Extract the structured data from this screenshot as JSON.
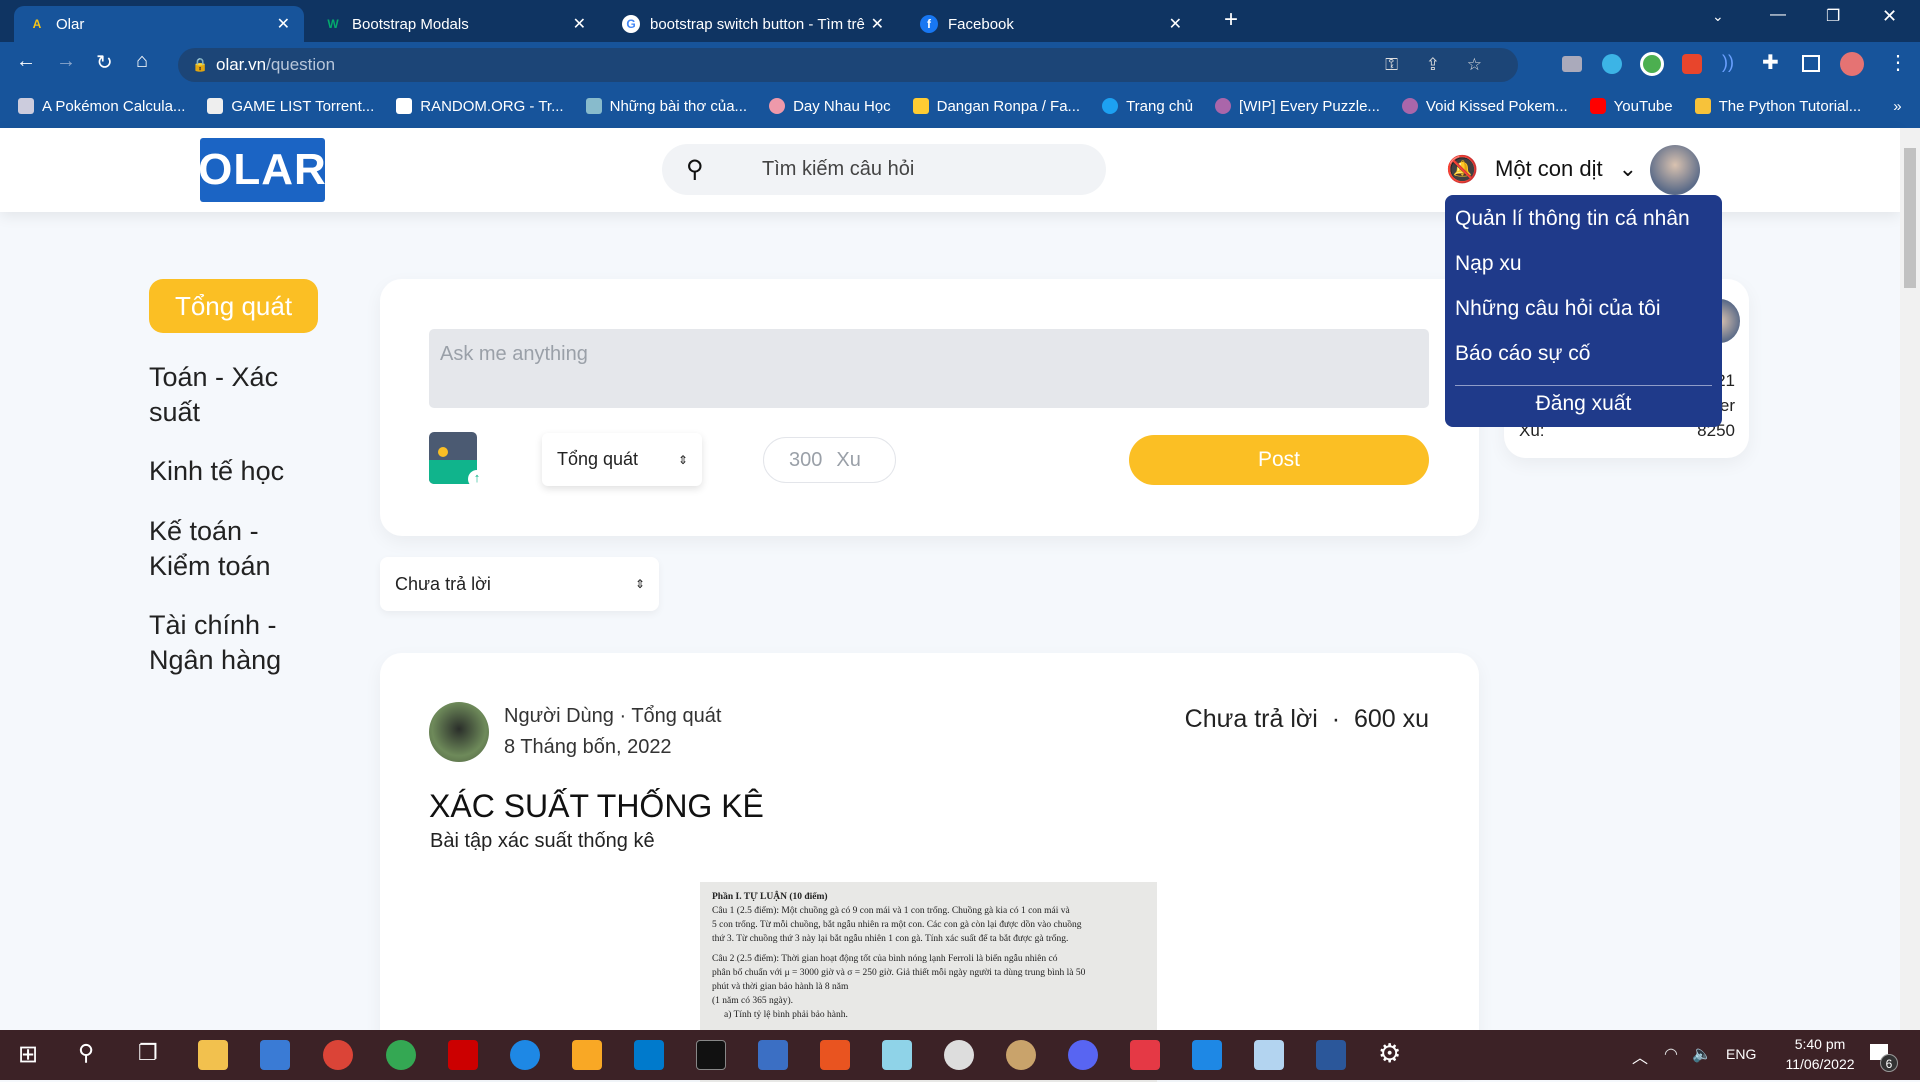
{
  "browser": {
    "tabs": [
      {
        "title": "Olar",
        "active": true
      },
      {
        "title": "Bootstrap Modals"
      },
      {
        "title": "bootstrap switch button - Tìm trê"
      },
      {
        "title": "Facebook"
      }
    ],
    "url_host": "olar.vn",
    "url_path": "/question",
    "bookmarks": [
      "A Pokémon Calcula...",
      "GAME LIST Torrent...",
      "RANDOM.ORG - Tr...",
      "Những bài thơ của...",
      "Day Nhau Học",
      "Dangan Ronpa / Fa...",
      "Trang chủ",
      "[WIP] Every Puzzle...",
      "Void Kissed Pokem...",
      "YouTube",
      "The Python Tutorial..."
    ],
    "bookmarks_more": "»"
  },
  "header": {
    "logo": "OLAR",
    "search_placeholder": "Tìm kiếm câu hỏi",
    "user_name": "Một con dịt"
  },
  "user_menu": {
    "items": [
      "Quản lí thông tin cá nhân",
      "Nạp xu",
      "Những câu hỏi của tôi",
      "Báo cáo sự cố"
    ],
    "logout": "Đăng xuất"
  },
  "sidebar": {
    "items": [
      "Tổng quát",
      "Toán - Xác suất",
      "Kinh tế học",
      "Kế toán - Kiểm toán",
      "Tài chính - Ngân hàng"
    ]
  },
  "composer": {
    "placeholder": "Ask me anything",
    "category": "Tổng quát",
    "xu_placeholder": "300",
    "xu_unit": "Xu",
    "post_label": "Post"
  },
  "filter": {
    "value": "Chưa trả lời"
  },
  "profile_card": {
    "frag1": "21",
    "frag2": "er",
    "xu_label": "Xu:",
    "xu_value": "8250"
  },
  "post": {
    "author": "Người Dùng",
    "category": "Tổng quát",
    "date": "8 Tháng bốn, 2022",
    "status": "Chưa trả lời",
    "reward": "600 xu",
    "title": "XÁC SUẤT THỐNG KÊ",
    "description": "Bài tập xác suất thống kê",
    "image_lines": [
      "Phần I. TỰ LUẬN (10 điểm)",
      "Câu 1 (2.5 điểm): Một chuồng gà có 9 con mái và 1 con trống. Chuồng gà kia có 1 con mái và",
      "5 con trống. Từ mỗi chuồng, bắt ngẫu nhiên ra một con. Các con gà còn lại được dồn vào chuồng",
      "thứ 3. Từ chuồng thứ 3 này lại bắt ngẫu nhiên 1 con gà. Tính xác suất để ta bắt được gà trống.",
      "Câu 2 (2.5 điểm): Thời gian hoạt động tốt của bình nóng lạnh Ferroli là biến ngẫu nhiên có",
      "phân bố chuẩn với μ = 3000 giờ và σ = 250 giờ. Giả thiết mỗi ngày người ta dùng trung bình là 50",
      "phút và thời gian bảo hành là 8 năm",
      "(1 năm có 365 ngày).",
      "a) Tính tỷ lệ bình phải bảo hành."
    ]
  },
  "taskbar": {
    "lang": "ENG",
    "time": "5:40 pm",
    "date": "11/06/2022",
    "notifications": "6"
  },
  "colors": {
    "accent": "#fbbf24",
    "menu": "#1f3a8a",
    "logo": "#1b64c4"
  }
}
